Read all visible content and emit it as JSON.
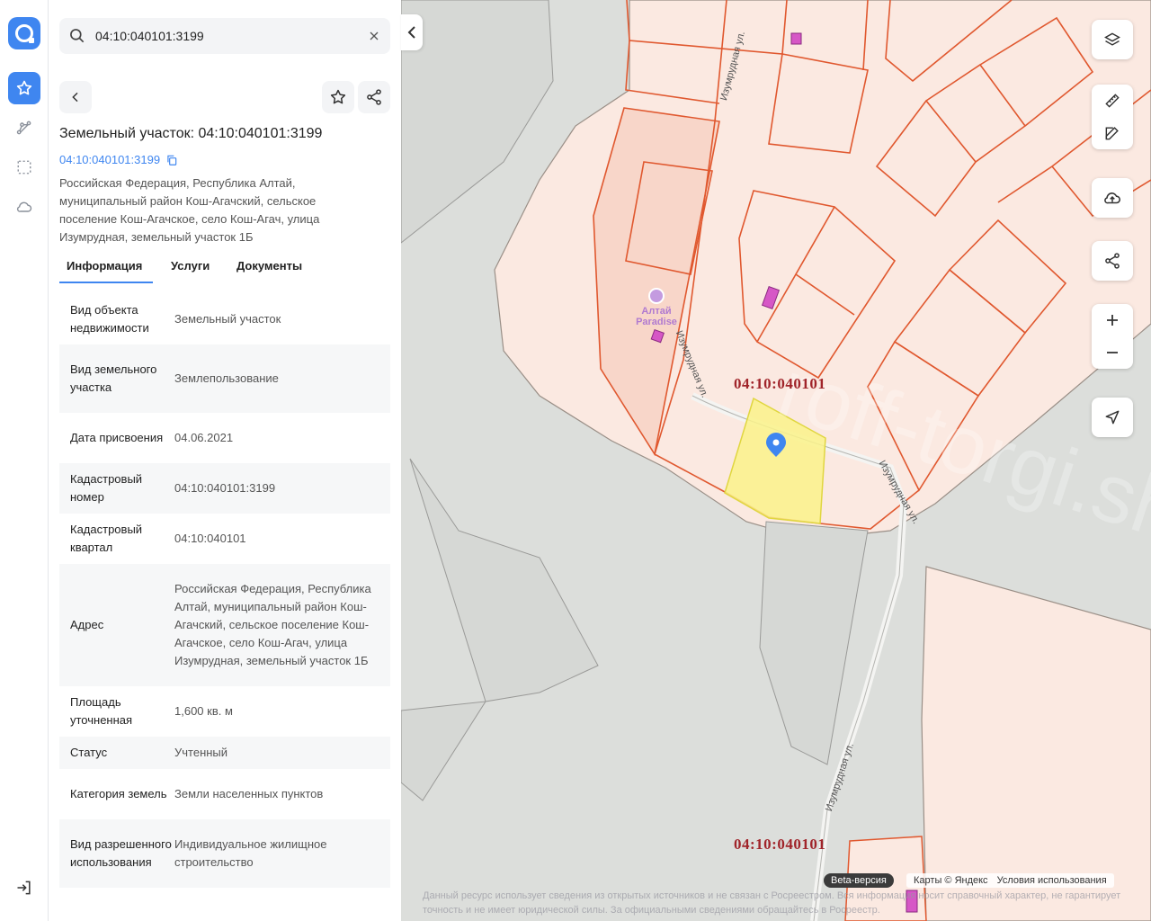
{
  "search": {
    "value": "04:10:040101:3199"
  },
  "panel": {
    "title": "Земельный участок: 04:10:040101:3199",
    "cad_link": "04:10:040101:3199",
    "address": "Российская Федерация, Республика Алтай, муниципальный район Кош-Агачский, сельское поселение Кош-Агачское, село Кош-Агач, улица Изумрудная, земельный участок 1Б",
    "tabs": [
      {
        "label": "Информация"
      },
      {
        "label": "Услуги"
      },
      {
        "label": "Документы"
      }
    ],
    "rows": [
      {
        "k": "Вид объекта недвижимости",
        "v": "Земельный участок"
      },
      {
        "k": "Вид земельного участка",
        "v": "Землепользование"
      },
      {
        "k": "Дата присвоения",
        "v": "04.06.2021"
      },
      {
        "k": "Кадастровый номер",
        "v": "04:10:040101:3199"
      },
      {
        "k": "Кадастровый квартал",
        "v": "04:10:040101"
      },
      {
        "k": "Адрес",
        "v": "Российская Федерация, Республика Алтай, муниципальный район Кош-Агачский, сельское поселение Кош-Агачское, село Кош-Агач, улица Изумрудная, земельный участок 1Б"
      },
      {
        "k": "Площадь уточненная",
        "v": "1,600 кв. м"
      },
      {
        "k": "Статус",
        "v": "Учтенный"
      },
      {
        "k": "Категория земель",
        "v": "Земли населенных пунктов"
      },
      {
        "k": "Вид разрешенного использования",
        "v": "Индивидуальное жилищное строительство"
      }
    ]
  },
  "map": {
    "quarter_label_1": "04:10:040101",
    "quarter_label_2": "04:10:040101",
    "street_1": "Изумрудная ул.",
    "street_2": "Изумрудная ул.",
    "street_3": "Изумрудная ул.",
    "street_4": "Изумрудная ул.",
    "poi": "Алтай Paradise",
    "watermark": "roff-torgi.shop",
    "beta": "Beta-версия",
    "attribution": "Карты © Яндекс",
    "terms": "Условия использования",
    "disclaimer": "Данный ресурс использует сведения из открытых источников и не связан с Росреестром. Вся информация носит справочный характер, не гарантирует точность и не имеет юридической силы. За официальными сведениями обращайтесь в Росреестр.",
    "colors": {
      "parcel_fill": "#fbe9e1",
      "parcel_stroke": "#e0582f",
      "selected_fill": "#faf28a",
      "accent": "#3f86f0"
    }
  },
  "icons": [
    "logo-icon",
    "star-icon",
    "route-icon",
    "select-area-icon",
    "cloud-icon",
    "search-icon",
    "close-icon",
    "back-icon",
    "share-icon",
    "copy-icon",
    "logout-icon",
    "layers-icon",
    "ruler-icon",
    "edit-icon",
    "upload-icon",
    "zoom-in-icon",
    "zoom-out-icon",
    "locate-icon",
    "pin-icon"
  ]
}
